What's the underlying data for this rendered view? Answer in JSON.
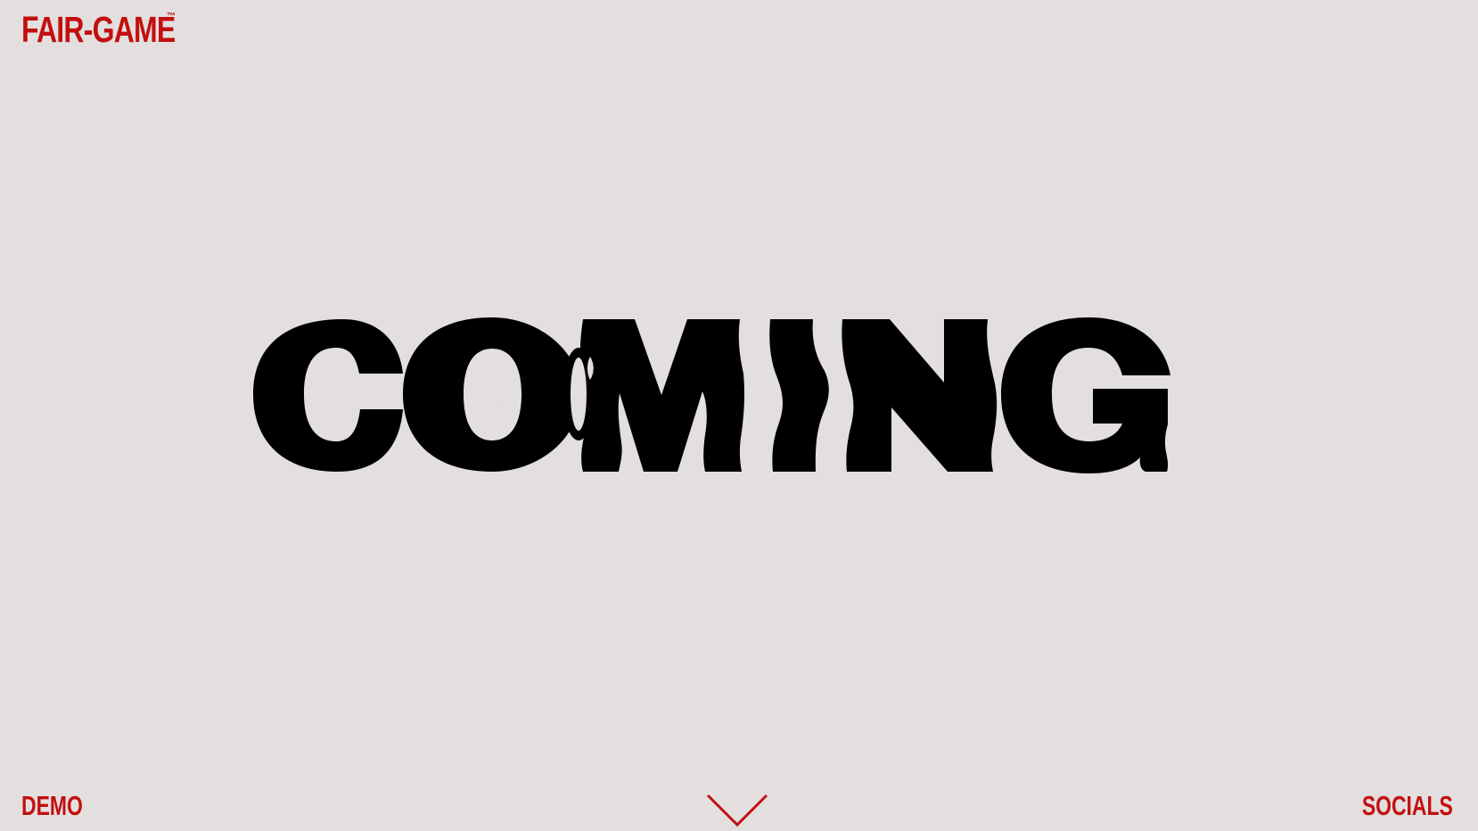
{
  "brand": {
    "name": "FAIR-GAME",
    "trademark": "™"
  },
  "hero": {
    "word": "COMING"
  },
  "nav": {
    "left_label": "DEMO",
    "right_label": "SOCIALS",
    "scroll_icon": "chevron-down-icon"
  },
  "colors": {
    "background": "#e3dfdf",
    "accent": "#c30f0f",
    "hero_text": "#000000"
  }
}
